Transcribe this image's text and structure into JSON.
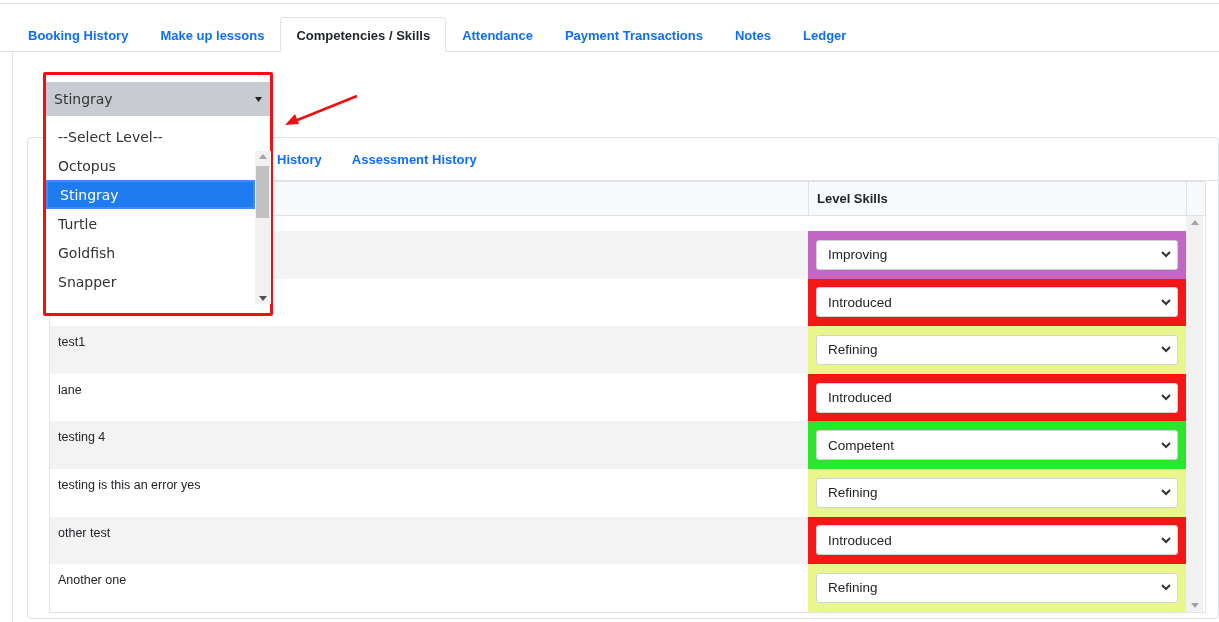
{
  "tabs": [
    {
      "label": "Booking History",
      "selected": false
    },
    {
      "label": "Make up lessons",
      "selected": false
    },
    {
      "label": "Competencies / Skills",
      "selected": true
    },
    {
      "label": "Attendance",
      "selected": false
    },
    {
      "label": "Payment Transactions",
      "selected": false
    },
    {
      "label": "Notes",
      "selected": false
    },
    {
      "label": "Ledger",
      "selected": false
    }
  ],
  "level_select": {
    "value": "Stingray",
    "expanded": true,
    "options": [
      {
        "label": "--Select Level--",
        "selected": false
      },
      {
        "label": "Octopus",
        "selected": false
      },
      {
        "label": "Stingray",
        "selected": true
      },
      {
        "label": "Turtle",
        "selected": false
      },
      {
        "label": "Goldfish",
        "selected": false
      },
      {
        "label": "Snapper",
        "selected": false
      }
    ]
  },
  "inner_tabs": [
    {
      "label": "History"
    },
    {
      "label": "Assessment History"
    }
  ],
  "table": {
    "columns": [
      "Level Skills"
    ],
    "rows": [
      {
        "level": "Improving",
        "color": "#c466c4"
      },
      {
        "level": "Introduced",
        "color": "#f61616"
      },
      {
        "skill": "test1",
        "level": "Refining",
        "color": "#e8f68c"
      },
      {
        "skill": "lane",
        "level": "Introduced",
        "color": "#f61616"
      },
      {
        "skill": "testing 4",
        "level": "Competent",
        "color": "#2ee52e"
      },
      {
        "skill": "testing is this an error yes",
        "level": "Refining",
        "color": "#e8f68c"
      },
      {
        "skill": "other test",
        "level": "Introduced",
        "color": "#f61616"
      },
      {
        "skill": "Another one",
        "level": "Refining",
        "color": "#e8f68c"
      }
    ]
  }
}
